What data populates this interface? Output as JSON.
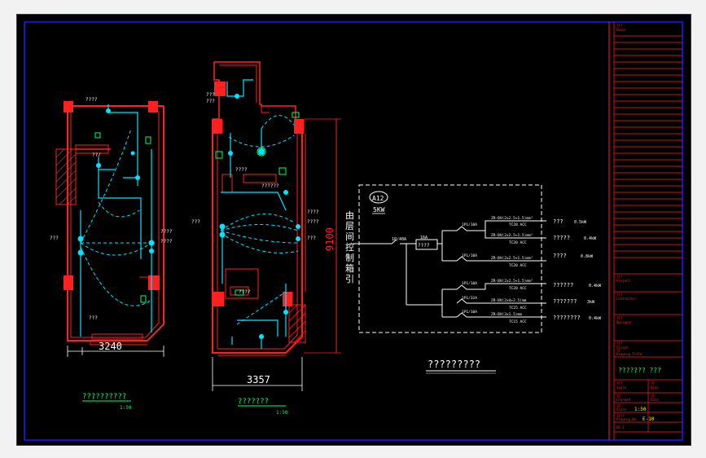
{
  "plans": {
    "left": {
      "dimension": "3240",
      "title": "??????????",
      "scale": "1:50",
      "labels": [
        "????",
        "??/",
        "???",
        "????",
        "????",
        "????",
        "????",
        "???"
      ]
    },
    "mid": {
      "dimension": "3357",
      "vertical_dimension": "9100",
      "title": "???????",
      "scale": "1:50",
      "labels": [
        "???",
        "???",
        "????",
        "??????",
        "???",
        "????",
        "????",
        "???",
        "????"
      ]
    }
  },
  "system": {
    "panel_id": "A12",
    "panel_power": "5KW",
    "vertical_text": "由层间控制箱引入",
    "main_breaker": "1P/40A",
    "meter": "????",
    "meter_label": "16A",
    "circuits": [
      {
        "breaker": "1P1/10A",
        "cable": "ZR-BV(2x2.5+1.5)mm²",
        "conduit": "TC20  ACC",
        "load": "???",
        "power": "0.5kW"
      },
      {
        "breaker": "",
        "cable": "ZR-BV(2x2.5+1.5)mm²",
        "conduit": "TC20  ACC",
        "load": "?????",
        "power": "0.4kW"
      },
      {
        "breaker": "1P1/10A",
        "cable": "ZR-BV(2x2.5+1.5)mm²",
        "conduit": "TC20  ACC",
        "load": "????",
        "power": "0.8kW"
      },
      {
        "breaker": "1P1/10A",
        "cable": "ZR-BV(2x2.5+1.5)mm²",
        "conduit": "TC20  ACC",
        "load": "??????",
        "power": "0.4kW"
      },
      {
        "breaker": "1P1/32A",
        "cable": "ZR-BV(2x4+2.5)mm",
        "conduit": "TC25  ACC",
        "load": "???????",
        "power": "3kW"
      },
      {
        "breaker": "1P1/10A",
        "cable": "ZR-BV(3x1.5)mm",
        "conduit": "TC15  ACC",
        "load": "????????",
        "power": "0.4kW"
      }
    ],
    "title": "?????????"
  },
  "title_block": {
    "fields": [
      "???",
      "Owner",
      "???",
      "Project",
      "???",
      "Contractor",
      "???",
      "Designer",
      "???",
      "Client",
      "??",
      "Drawing Title",
      "???",
      "Scale",
      "??",
      "Date",
      "??",
      "Checked",
      "??",
      "Date",
      "??",
      "Scale",
      "????",
      "Drawing No."
    ],
    "drawing_title": "??????? ???",
    "scale_value": "1:50",
    "drawing_no": "E-10",
    "sheet": "DE-1"
  },
  "colors": {
    "background": "#000000",
    "frame": "#1a1aff",
    "wall": "#ff2020",
    "wire": "#00e5ff",
    "text": "#ffffff",
    "green": "#00ff66",
    "yellow": "#ffff00"
  }
}
